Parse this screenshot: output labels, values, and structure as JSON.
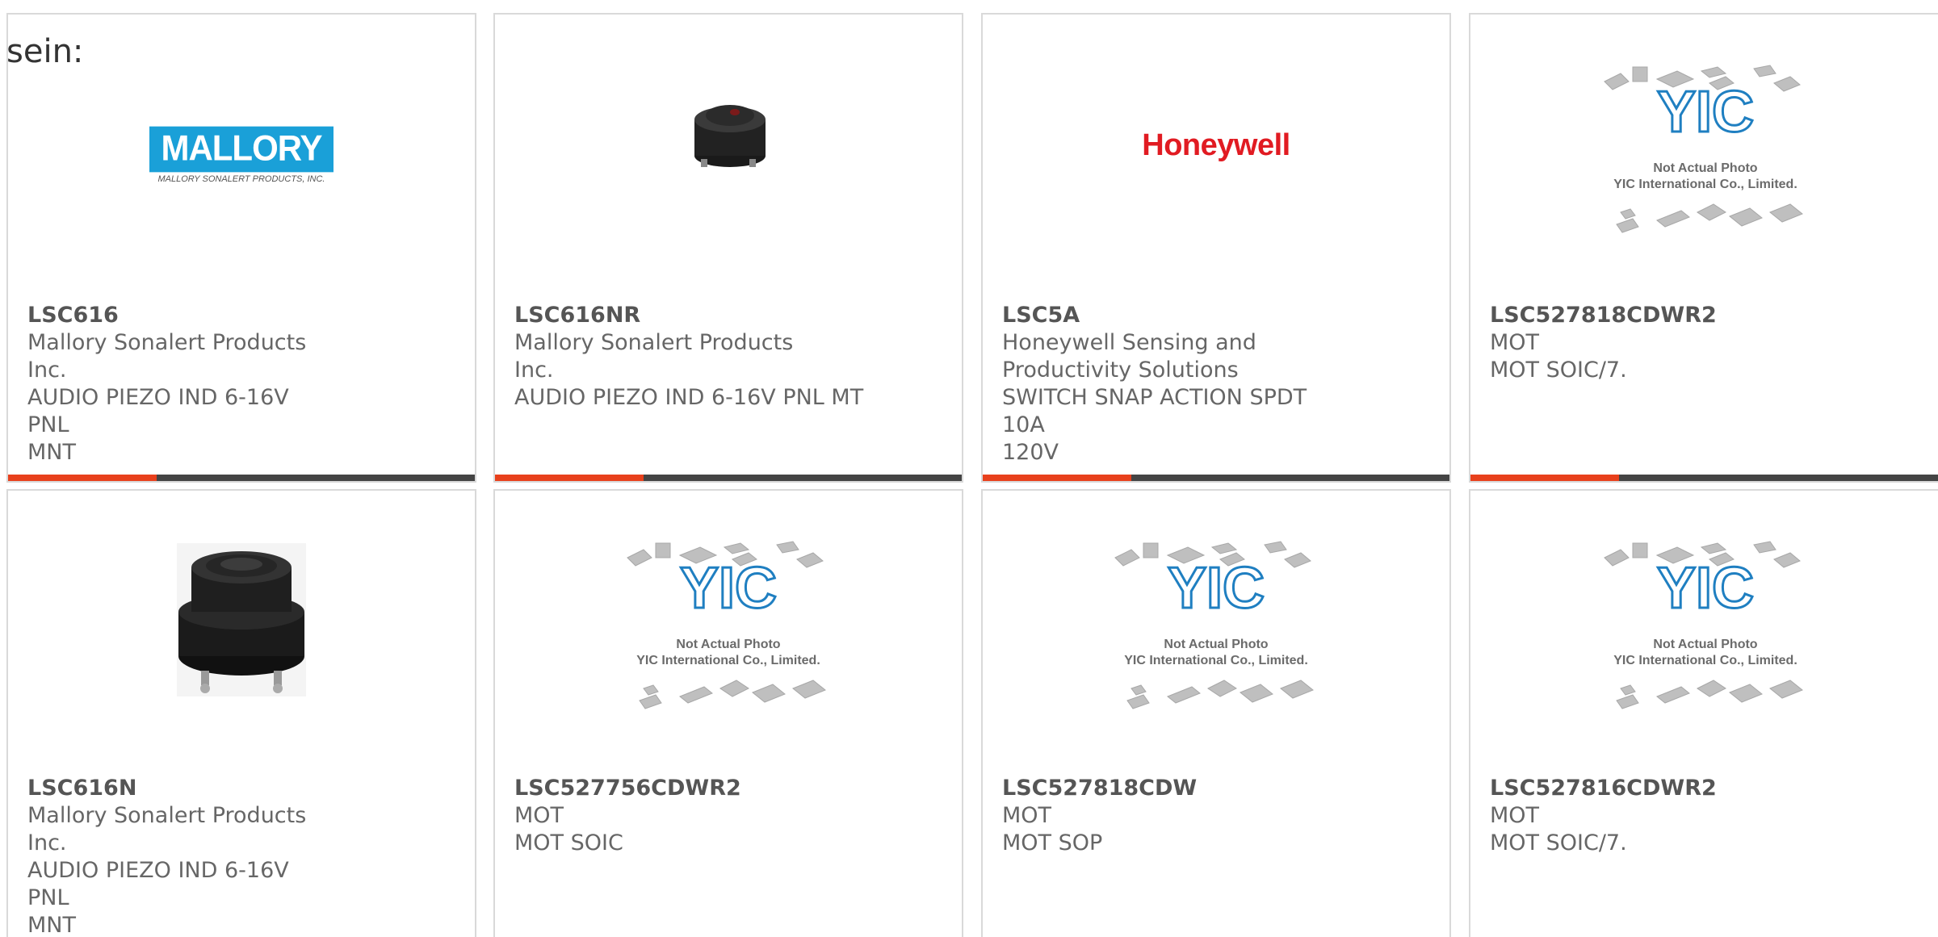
{
  "header": {
    "text": "sein:"
  },
  "colors": {
    "accent": "#e8401c",
    "bar": "#444444",
    "border": "#d9d9d9",
    "text": "#666666"
  },
  "placeholder": {
    "line1": "Not Actual Photo",
    "line2": "YIC International Co., Limited.",
    "logo_text": "YIC"
  },
  "products": [
    {
      "part": "LSC616",
      "maker": "Mallory Sonalert Products Inc.",
      "desc_lines": [
        "AUDIO PIEZO IND 6-16V PNL",
        "MNT"
      ],
      "image": "mallory-logo",
      "logo_main": "MALLORY",
      "logo_sub": "MALLORY SONALERT PRODUCTS, INC."
    },
    {
      "part": "LSC616NR",
      "maker": "Mallory Sonalert Products Inc.",
      "desc_lines": [
        "AUDIO PIEZO IND 6-16V PNL MT"
      ],
      "image": "buzzer-small"
    },
    {
      "part": "LSC5A",
      "maker_lines": [
        "Honeywell Sensing and",
        "Productivity Solutions"
      ],
      "desc_lines": [
        "SWITCH SNAP ACTION SPDT 10A",
        "120V"
      ],
      "image": "honeywell-logo",
      "logo_main": "Honeywell"
    },
    {
      "part": "LSC527818CDWR2",
      "maker": "MOT",
      "desc_lines": [
        "MOT SOIC/7."
      ],
      "image": "yic-placeholder"
    },
    {
      "part": "LSC616N",
      "maker": "Mallory Sonalert Products Inc.",
      "desc_lines": [
        "AUDIO PIEZO IND 6-16V PNL",
        "MNT"
      ],
      "image": "buzzer-large"
    },
    {
      "part": "LSC527756CDWR2",
      "maker": "MOT",
      "desc_lines": [
        "MOT SOIC"
      ],
      "image": "yic-placeholder"
    },
    {
      "part": "LSC527818CDW",
      "maker": "MOT",
      "desc_lines": [
        "MOT SOP"
      ],
      "image": "yic-placeholder"
    },
    {
      "part": "LSC527816CDWR2",
      "maker": "MOT",
      "desc_lines": [
        "MOT SOIC/7."
      ],
      "image": "yic-placeholder"
    }
  ]
}
